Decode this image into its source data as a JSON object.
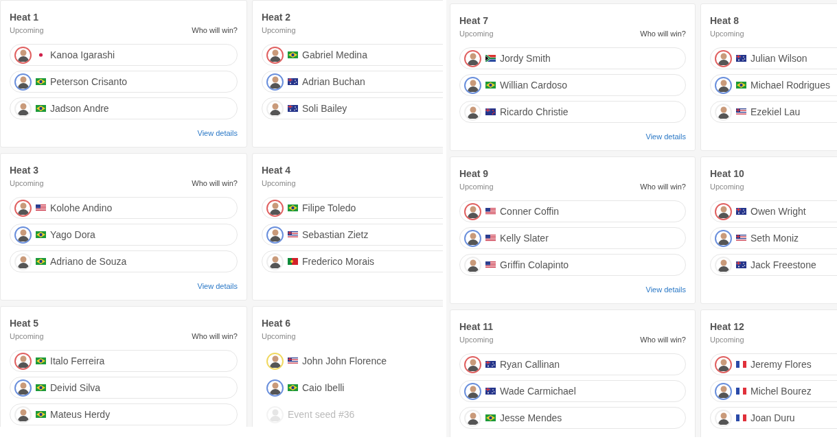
{
  "panels": [
    {
      "heats": [
        {
          "title": "Heat 1",
          "status": "Upcoming",
          "prompt": "Who will win?",
          "link": "View details",
          "voting": true,
          "surfers": [
            {
              "kind": "surfer",
              "name": "Kanoa Igarashi",
              "flag": {
                "kind": "jp"
              },
              "color": "#e06060"
            },
            {
              "kind": "surfer",
              "name": "Peterson Crisanto",
              "flag": {
                "kind": "br"
              },
              "color": "#6a8fdc"
            },
            {
              "kind": "surfer",
              "name": "Jadson Andre",
              "flag": {
                "kind": "br"
              },
              "color": "#eeeeee"
            }
          ]
        },
        {
          "title": "Heat 2",
          "status": "Upcoming",
          "voting": true,
          "surfers": [
            {
              "kind": "surfer",
              "name": "Gabriel Medina",
              "flag": {
                "kind": "br"
              },
              "color": "#e06060"
            },
            {
              "kind": "surfer",
              "name": "Adrian Buchan",
              "flag": {
                "kind": "au"
              },
              "color": "#6a8fdc"
            },
            {
              "kind": "surfer",
              "name": "Soli Bailey",
              "flag": {
                "kind": "au"
              },
              "color": "#eeeeee"
            }
          ]
        },
        {
          "title": "Heat 3",
          "status": "Upcoming",
          "prompt": "Who will win?",
          "link": "View details",
          "voting": true,
          "surfers": [
            {
              "kind": "surfer",
              "name": "Kolohe Andino",
              "flag": {
                "kind": "us"
              },
              "color": "#e06060"
            },
            {
              "kind": "surfer",
              "name": "Yago Dora",
              "flag": {
                "kind": "br"
              },
              "color": "#6a8fdc"
            },
            {
              "kind": "surfer",
              "name": "Adriano de Souza",
              "flag": {
                "kind": "br"
              },
              "color": "#eeeeee"
            }
          ]
        },
        {
          "title": "Heat 4",
          "status": "Upcoming",
          "voting": true,
          "surfers": [
            {
              "kind": "surfer",
              "name": "Filipe Toledo",
              "flag": {
                "kind": "br"
              },
              "color": "#e06060"
            },
            {
              "kind": "surfer",
              "name": "Sebastian Zietz",
              "flag": {
                "kind": "hi"
              },
              "color": "#6a8fdc"
            },
            {
              "kind": "surfer",
              "name": "Frederico Morais",
              "flag": {
                "kind": "pt"
              },
              "color": "#eeeeee"
            }
          ]
        },
        {
          "title": "Heat 5",
          "status": "Upcoming",
          "prompt": "Who will win?",
          "voting": true,
          "surfers": [
            {
              "kind": "surfer",
              "name": "Italo Ferreira",
              "flag": {
                "kind": "br"
              },
              "color": "#e06060"
            },
            {
              "kind": "surfer",
              "name": "Deivid Silva",
              "flag": {
                "kind": "br"
              },
              "color": "#6a8fdc"
            },
            {
              "kind": "surfer",
              "name": "Mateus Herdy",
              "flag": {
                "kind": "br"
              },
              "color": "#eeeeee"
            }
          ]
        },
        {
          "title": "Heat 6",
          "status": "Upcoming",
          "voting": false,
          "surfers": [
            {
              "kind": "surfer",
              "name": "John John Florence",
              "flag": {
                "kind": "hi"
              },
              "color": "#f0d860"
            },
            {
              "kind": "surfer",
              "name": "Caio Ibelli",
              "flag": {
                "kind": "br"
              },
              "color": "#6a8fdc"
            },
            {
              "kind": "seed",
              "name": "Event seed #36"
            }
          ]
        }
      ]
    },
    {
      "heats": [
        {
          "title": "Heat 7",
          "status": "Upcoming",
          "prompt": "Who will win?",
          "link": "View details",
          "voting": true,
          "surfers": [
            {
              "kind": "surfer",
              "name": "Jordy Smith",
              "flag": {
                "kind": "za"
              },
              "color": "#e06060"
            },
            {
              "kind": "surfer",
              "name": "Willian Cardoso",
              "flag": {
                "kind": "br"
              },
              "color": "#6a8fdc"
            },
            {
              "kind": "surfer",
              "name": "Ricardo Christie",
              "flag": {
                "kind": "nz"
              },
              "color": "#eeeeee"
            }
          ]
        },
        {
          "title": "Heat 8",
          "status": "Upcoming",
          "voting": true,
          "surfers": [
            {
              "kind": "surfer",
              "name": "Julian Wilson",
              "flag": {
                "kind": "au"
              },
              "color": "#e06060"
            },
            {
              "kind": "surfer",
              "name": "Michael Rodrigues",
              "flag": {
                "kind": "br"
              },
              "color": "#6a8fdc"
            },
            {
              "kind": "surfer",
              "name": "Ezekiel Lau",
              "flag": {
                "kind": "hi"
              },
              "color": "#eeeeee"
            }
          ]
        },
        {
          "title": "Heat 9",
          "status": "Upcoming",
          "prompt": "Who will win?",
          "link": "View details",
          "voting": true,
          "surfers": [
            {
              "kind": "surfer",
              "name": "Conner Coffin",
              "flag": {
                "kind": "us"
              },
              "color": "#e06060"
            },
            {
              "kind": "surfer",
              "name": "Kelly Slater",
              "flag": {
                "kind": "us"
              },
              "color": "#6a8fdc"
            },
            {
              "kind": "surfer",
              "name": "Griffin Colapinto",
              "flag": {
                "kind": "us"
              },
              "color": "#eeeeee"
            }
          ]
        },
        {
          "title": "Heat 10",
          "status": "Upcoming",
          "voting": true,
          "surfers": [
            {
              "kind": "surfer",
              "name": "Owen Wright",
              "flag": {
                "kind": "au"
              },
              "color": "#e06060"
            },
            {
              "kind": "surfer",
              "name": "Seth Moniz",
              "flag": {
                "kind": "hi"
              },
              "color": "#6a8fdc"
            },
            {
              "kind": "surfer",
              "name": "Jack Freestone",
              "flag": {
                "kind": "au"
              },
              "color": "#eeeeee"
            }
          ]
        },
        {
          "title": "Heat 11",
          "status": "Upcoming",
          "prompt": "Who will win?",
          "voting": true,
          "surfers": [
            {
              "kind": "surfer",
              "name": "Ryan Callinan",
              "flag": {
                "kind": "au"
              },
              "color": "#e06060"
            },
            {
              "kind": "surfer",
              "name": "Wade Carmichael",
              "flag": {
                "kind": "au"
              },
              "color": "#6a8fdc"
            },
            {
              "kind": "surfer",
              "name": "Jesse Mendes",
              "flag": {
                "kind": "br"
              },
              "color": "#eeeeee"
            }
          ]
        },
        {
          "title": "Heat 12",
          "status": "Upcoming",
          "voting": true,
          "surfers": [
            {
              "kind": "surfer",
              "name": "Jeremy Flores",
              "flag": {
                "kind": "fr"
              },
              "color": "#e06060"
            },
            {
              "kind": "surfer",
              "name": "Michel Bourez",
              "flag": {
                "kind": "fr"
              },
              "color": "#6a8fdc"
            },
            {
              "kind": "surfer",
              "name": "Joan Duru",
              "flag": {
                "kind": "fr"
              },
              "color": "#eeeeee"
            }
          ]
        }
      ]
    }
  ]
}
